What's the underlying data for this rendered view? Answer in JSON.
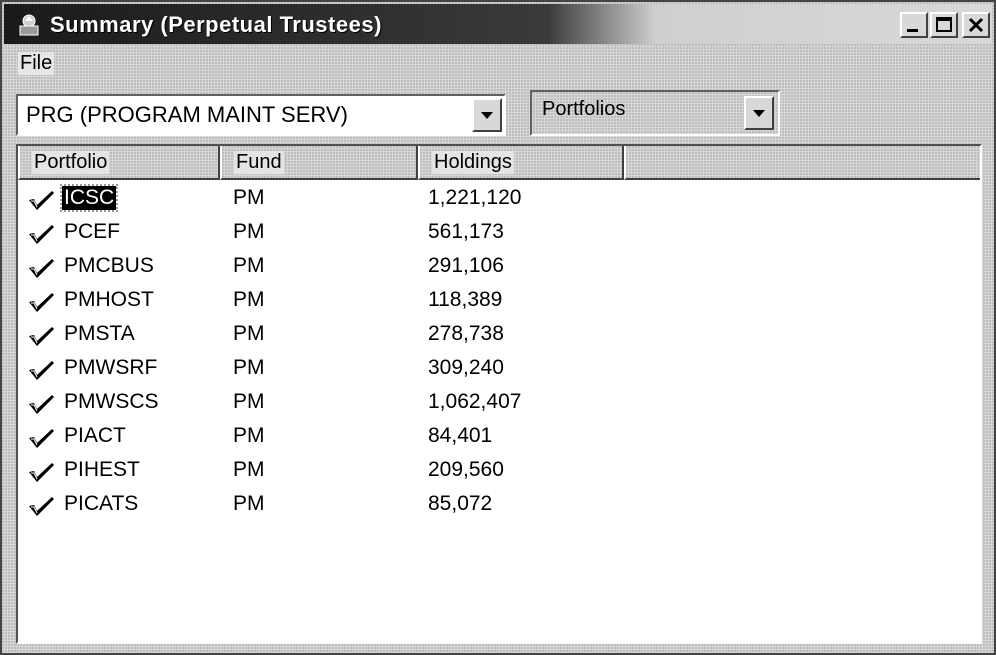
{
  "window": {
    "title": "Summary (Perpetual Trustees)",
    "controls": [
      "minimize-icon",
      "maximize-icon",
      "close-icon"
    ]
  },
  "menu": {
    "file": "File"
  },
  "selectors": {
    "program": "PRG (PROGRAM MAINT SERV)",
    "view": "Portfolios"
  },
  "table": {
    "headers": [
      "Portfolio",
      "Fund",
      "Holdings"
    ],
    "rows": [
      {
        "portfolio": "ICSC",
        "fund": "PM",
        "holdings": "1,221,120",
        "selected": true
      },
      {
        "portfolio": "PCEF",
        "fund": "PM",
        "holdings": "561,173"
      },
      {
        "portfolio": "PMCBUS",
        "fund": "PM",
        "holdings": "291,106"
      },
      {
        "portfolio": "PMHOST",
        "fund": "PM",
        "holdings": "118,389"
      },
      {
        "portfolio": "PMSTA",
        "fund": "PM",
        "holdings": "278,738"
      },
      {
        "portfolio": "PMWSRF",
        "fund": "PM",
        "holdings": "309,240"
      },
      {
        "portfolio": "PMWSCS",
        "fund": "PM",
        "holdings": "1,062,407"
      },
      {
        "portfolio": "PIACT",
        "fund": "PM",
        "holdings": "84,401"
      },
      {
        "portfolio": "PIHEST",
        "fund": "PM",
        "holdings": "209,560"
      },
      {
        "portfolio": "PICATS",
        "fund": "PM",
        "holdings": "85,072"
      }
    ]
  }
}
